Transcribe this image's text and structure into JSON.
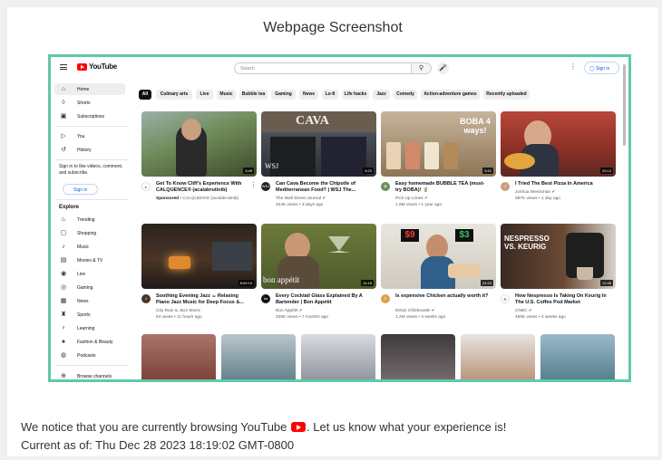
{
  "page_title": "Webpage Screenshot",
  "youtube": {
    "logo_text": "YouTube",
    "search_placeholder": "Search",
    "signin_label": "Sign in",
    "sidebar": {
      "top_items": [
        {
          "label": "Home",
          "icon": "home-icon",
          "active": true
        },
        {
          "label": "Shorts",
          "icon": "shorts-icon"
        },
        {
          "label": "Subscriptions",
          "icon": "subscriptions-icon"
        }
      ],
      "you_items": [
        {
          "label": "You",
          "icon": "you-icon"
        },
        {
          "label": "History",
          "icon": "history-icon"
        }
      ],
      "signin_note": "Sign in to like videos, comment, and subscribe.",
      "signin_label": "Sign in",
      "explore_heading": "Explore",
      "explore_items": [
        {
          "label": "Trending",
          "icon": "trending-icon"
        },
        {
          "label": "Shopping",
          "icon": "shopping-icon"
        },
        {
          "label": "Music",
          "icon": "music-icon"
        },
        {
          "label": "Movies & TV",
          "icon": "movies-icon"
        },
        {
          "label": "Live",
          "icon": "live-icon"
        },
        {
          "label": "Gaming",
          "icon": "gaming-icon"
        },
        {
          "label": "News",
          "icon": "news-icon"
        },
        {
          "label": "Sports",
          "icon": "sports-icon"
        },
        {
          "label": "Learning",
          "icon": "learning-icon"
        },
        {
          "label": "Fashion & Beauty",
          "icon": "fashion-icon"
        },
        {
          "label": "Podcasts",
          "icon": "podcasts-icon"
        }
      ],
      "browse_channels": "Browse channels"
    },
    "chips": [
      "All",
      "Culinary arts",
      "Live",
      "Music",
      "Bubble tea",
      "Gaming",
      "News",
      "Lo-fi",
      "Life hacks",
      "Jazz",
      "Comedy",
      "Action-adventure games",
      "Recently uploaded"
    ],
    "videos_row1": [
      {
        "title": "Get To Know Cliff's Experience With CALQUENCE® (acalabrutinib)",
        "channel": "CALQUENCE (acalabrutinib)",
        "meta": "",
        "sponsored": "Sponsored",
        "duration": "3:48"
      },
      {
        "title": "Can Cava Become the Chipotle of Mediterranean Food? | WSJ The...",
        "channel": "The Wall Street Journal ✔",
        "meta": "344K views • 3 days ago",
        "duration": "6:23"
      },
      {
        "title": "Easy homemade BUBBLE TEA (must-try BOBA)! 🧋",
        "channel": "Pick Up Limes ✔",
        "meta": "1.9M views • 1 year ago",
        "duration": "9:41"
      },
      {
        "title": "I Tried The Best Pizza In America",
        "channel": "Joshua Weissman ✔",
        "meta": "987K views • 1 day ago",
        "duration": "20:13"
      }
    ],
    "videos_row2": [
      {
        "title": "Soothing Evening Jazz ☕ Relaxing Piano Jazz Music for Deep Focus &...",
        "channel": "City Rain & Jazz Music",
        "meta": "64 views • 11 hours ago",
        "duration": "8:00:15"
      },
      {
        "title": "Every Cocktail Glass Explained By A Bartender | Bon Appétit",
        "channel": "Bon Appétit ✔",
        "meta": "335K views • 7 months ago",
        "duration": "14:18"
      },
      {
        "title": "Is expensive Chicken actually worth it?",
        "channel": "Ethan Chlebowski ✔",
        "meta": "1.2M views • 3 weeks ago",
        "duration": "24:23"
      },
      {
        "title": "How Nespresso Is Taking On Keurig In The U.S. Coffee Pod Market",
        "channel": "CNBC ✔",
        "meta": "455K views • 4 weeks ago",
        "duration": "12:45"
      }
    ],
    "thumb_text": {
      "cava": "CAVA",
      "wsj": "WSJ",
      "boba": "BOBA 4 ways!",
      "bonappetit": "bon appétit",
      "price1": "$9",
      "price2": "$3",
      "nespresso": "NESPRESSO VS. KEURIG"
    }
  },
  "notice": {
    "before": "We notice that you are currently browsing YouTube",
    "after": ". Let us know what your experience is!",
    "current": "Current as of: Thu Dec 28 2023 18:19:02 GMT-0800"
  }
}
